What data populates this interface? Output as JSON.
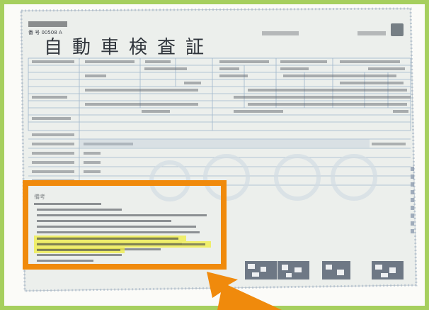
{
  "photo": {
    "document_title": "自動車検査証",
    "notes_heading": "備考"
  }
}
